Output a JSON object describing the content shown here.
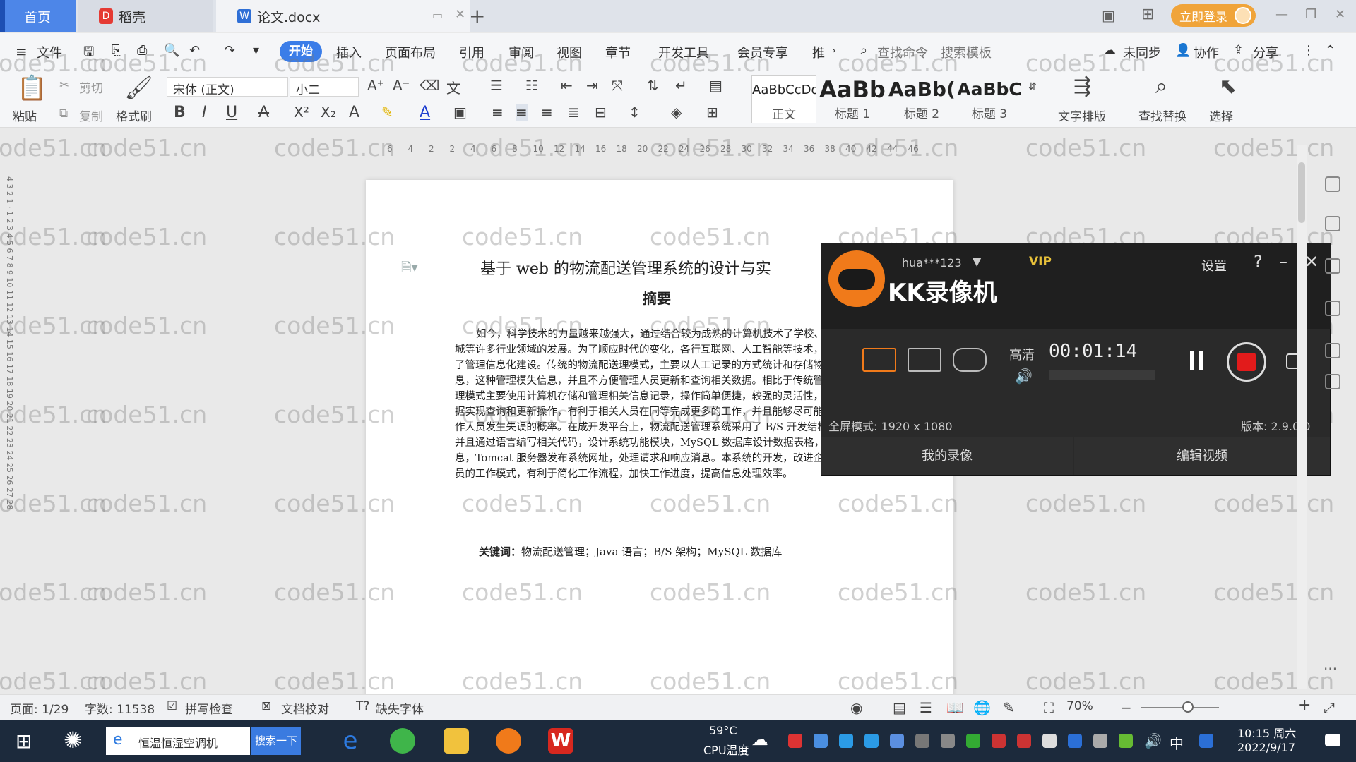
{
  "tabs": {
    "home": "首页",
    "daoke": "稻壳",
    "doc": "论文.docx"
  },
  "login": "立即登录",
  "menu": {
    "file": "文件",
    "start": "开始",
    "insert": "插入",
    "layout": "页面布局",
    "ref": "引用",
    "review": "审阅",
    "view": "视图",
    "chapter": "章节",
    "dev": "开发工具",
    "vip": "会员专享",
    "more": "推",
    "find_cmd": "查找命令",
    "search_tpl": "搜索模板",
    "sync": "未同步",
    "collab": "协作",
    "share": "分享"
  },
  "ribbon": {
    "paste": "粘贴",
    "cut": "剪切",
    "copy": "复制",
    "format_painter": "格式刷",
    "font": "宋体 (正文)",
    "size": "小二",
    "styles": [
      {
        "sample": "AaBbCcDd",
        "name": "正文"
      },
      {
        "sample": "AaBb",
        "name": "标题 1"
      },
      {
        "sample": "AaBb(",
        "name": "标题 2"
      },
      {
        "sample": "AaBbC",
        "name": "标题 3"
      }
    ],
    "text_layout": "文字排版",
    "find_replace": "查找替换",
    "select": "选择"
  },
  "ruler": [
    "6",
    "4",
    "2",
    "2",
    "4",
    "6",
    "8",
    "10",
    "12",
    "14",
    "16",
    "18",
    "20",
    "22",
    "24",
    "26",
    "28",
    "30",
    "32",
    "34",
    "36",
    "38",
    "40",
    "42",
    "44",
    "46"
  ],
  "document": {
    "title": "基于 web 的物流配送管理系统的设计与实",
    "abstract_heading": "摘要",
    "body": "如今，科学技术的力量越来越强大，通过结合较为成熟的计算机技术了学校、医疗、商城等许多行业领域的发展。为了顺应时代的变化，各行互联网、人工智能等技术，纷纷开展了管理信息化建设。传统的物流配送理模式，主要以人工记录的方式统计和存储物流配送信息，这种管理模失信息，并且不方便管理人员更新和查询相关数据。相比于传统管理模化管理模式主要使用计算机存储和管理相关信息记录，操作简单便捷，较强的灵活性，容易对数据实现查询和更新操作，有利于相关人员在同等完成更多的工作，并且能够尽可能的减少工作人员发生失误的概率。在成开发平台上，物流配送管理系统采用了 B/S 开发结构模式，并且通过语言编写相关代码，设计系统功能模块，MySQL 数据库设计数据表格，流配送信息，Tomcat 服务器发布系统网址，处理请求和响应消息。本系统的开发，改进企业管理人员的工作模式，有利于简化工作流程，加快工作进度，提高信息处理效率。",
    "keywords_label": "关键词：",
    "keywords": "物流配送管理；Java 语言；B/S 架构；MySQL 数据库"
  },
  "watermark": "code51.cn",
  "kk": {
    "user": "hua***123",
    "vip": "VIP",
    "settings": "设置",
    "help": "?",
    "title": "KK录像机",
    "quality": "高清",
    "time": "00:01:14",
    "mode": "全屏模式: 1920 x 1080",
    "version": "版本: 2.9.0.0",
    "my_videos": "我的录像",
    "edit_video": "编辑视频"
  },
  "status": {
    "page": "页面: 1/29",
    "words": "字数: 11538",
    "spell": "拼写检查",
    "proof": "文档校对",
    "missing_font": "缺失字体",
    "zoom": "70%"
  },
  "taskbar": {
    "search": "恒温恒湿空调机",
    "search_btn": "搜索一下",
    "temp": "59°C",
    "temp_label": "CPU温度",
    "ime": "中",
    "time": "10:15 周六",
    "date": "2022/9/17"
  }
}
